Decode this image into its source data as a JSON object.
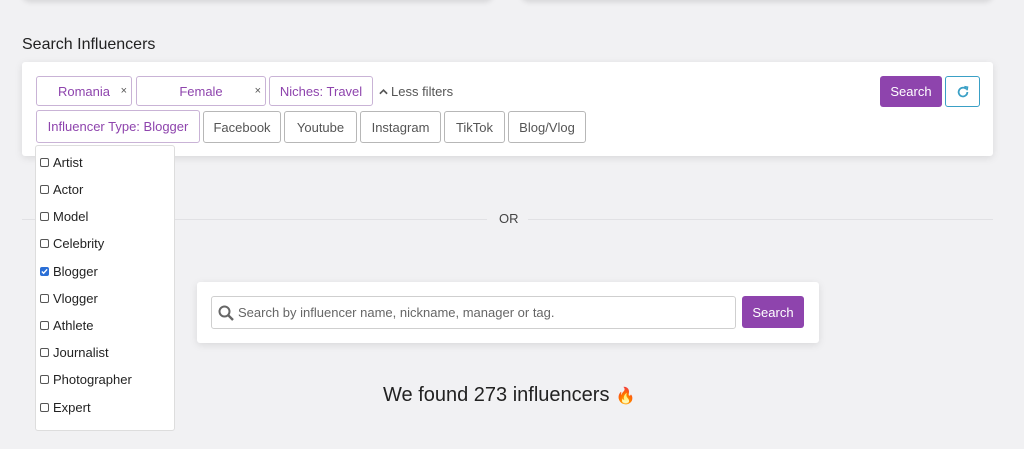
{
  "title": "Search Influencers",
  "filters": {
    "country": "Romania",
    "gender": "Female",
    "niches": "Niches: Travel",
    "less_filters": "Less filters",
    "influencer_type": "Influencer Type: Blogger",
    "platforms": [
      "Facebook",
      "Youtube",
      "Instagram",
      "TikTok",
      "Blog/Vlog"
    ],
    "search_label": "Search",
    "remove_glyph": "×"
  },
  "influencer_types": [
    {
      "label": "Artist",
      "checked": false
    },
    {
      "label": "Actor",
      "checked": false
    },
    {
      "label": "Model",
      "checked": false
    },
    {
      "label": "Celebrity",
      "checked": false
    },
    {
      "label": "Blogger",
      "checked": true
    },
    {
      "label": "Vlogger",
      "checked": false
    },
    {
      "label": "Athlete",
      "checked": false
    },
    {
      "label": "Journalist",
      "checked": false
    },
    {
      "label": "Photographer",
      "checked": false
    },
    {
      "label": "Expert",
      "checked": false
    }
  ],
  "or_label": "OR",
  "name_search": {
    "placeholder": "Search by influencer name, nickname, manager or tag.",
    "button_label": "Search"
  },
  "results": {
    "text": "We found 273 influencers",
    "emoji": "🔥"
  },
  "colors": {
    "accent": "#8e44ad",
    "refresh": "#3aa0c6",
    "checkbox": "#2b6fd6"
  }
}
